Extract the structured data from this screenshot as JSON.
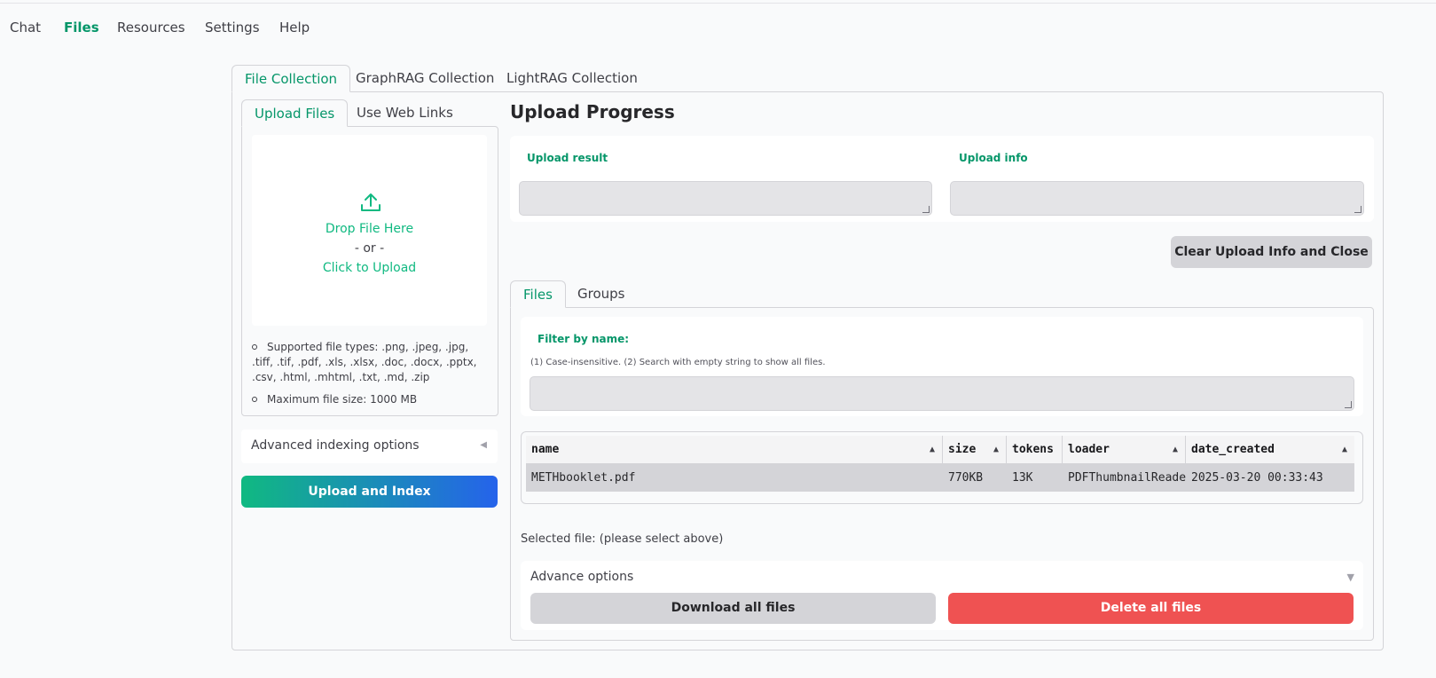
{
  "nav": {
    "items": [
      {
        "label": "Chat"
      },
      {
        "label": "Files"
      },
      {
        "label": "Resources"
      },
      {
        "label": "Settings"
      },
      {
        "label": "Help"
      }
    ],
    "active": "Files"
  },
  "collection_tabs": {
    "items": [
      {
        "label": "File Collection"
      },
      {
        "label": "GraphRAG Collection"
      },
      {
        "label": "LightRAG Collection"
      }
    ],
    "active": "File Collection"
  },
  "upload_tabs": {
    "items": [
      {
        "label": "Upload Files"
      },
      {
        "label": "Use Web Links"
      }
    ],
    "active": "Upload Files"
  },
  "dropzone": {
    "icon": "upload-icon",
    "drop_text": "Drop File Here",
    "or_text": "- or -",
    "click_text": "Click to Upload"
  },
  "notes": {
    "supported": "Supported file types: .png, .jpeg, .jpg, .tiff, .tif, .pdf, .xls, .xlsx, .doc, .docx, .pptx, .csv, .html, .mhtml, .txt, .md, .zip",
    "max_size": "Maximum file size: 1000 MB"
  },
  "advanced_indexing": {
    "label": "Advanced indexing options",
    "icon": "triangle-left-icon"
  },
  "upload_button": {
    "label": "Upload and Index"
  },
  "progress": {
    "title": "Upload Progress",
    "result_label": "Upload result",
    "result_value": "",
    "info_label": "Upload info",
    "info_value": "",
    "clear_button": "Clear Upload Info and Close"
  },
  "file_tabs": {
    "items": [
      {
        "label": "Files"
      },
      {
        "label": "Groups"
      }
    ],
    "active": "Files"
  },
  "filter": {
    "label": "Filter by name:",
    "hint": "(1) Case-insensitive. (2) Search with empty string to show all files.",
    "value": ""
  },
  "table": {
    "columns": [
      "name",
      "size",
      "tokens",
      "loader",
      "date_created"
    ],
    "rows": [
      {
        "name": "METHbooklet.pdf",
        "size": "770KB",
        "tokens": "13K",
        "loader": "PDFThumbnailReader",
        "date_created": "2025-03-20 00:33:43"
      }
    ]
  },
  "selected_file": "Selected file: (please select above)",
  "advance_options": {
    "label": "Advance options",
    "icon": "triangle-down-icon",
    "download_button": "Download all files",
    "delete_button": "Delete all files"
  },
  "colors": {
    "accent": "#059669",
    "danger": "#ef5252",
    "gradient_start": "#10b981",
    "gradient_end": "#2563eb"
  }
}
